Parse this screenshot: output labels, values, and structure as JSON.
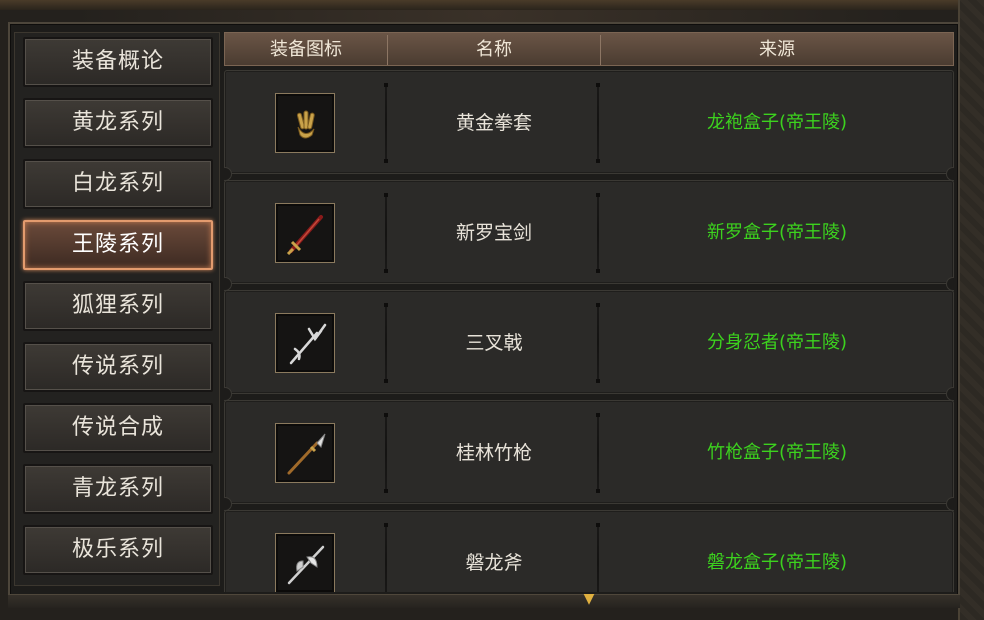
{
  "sidebar": {
    "items": [
      {
        "label": "装备概论",
        "active": false
      },
      {
        "label": "黄龙系列",
        "active": false
      },
      {
        "label": "白龙系列",
        "active": false
      },
      {
        "label": "王陵系列",
        "active": true
      },
      {
        "label": "狐狸系列",
        "active": false
      },
      {
        "label": "传说系列",
        "active": false
      },
      {
        "label": "传说合成",
        "active": false
      },
      {
        "label": "青龙系列",
        "active": false
      },
      {
        "label": "极乐系列",
        "active": false
      }
    ]
  },
  "table": {
    "headers": [
      "装备图标",
      "名称",
      "来源"
    ],
    "rows": [
      {
        "icon": "gold-gauntlet-icon",
        "name": "黄金拳套",
        "source": "龙袍盒子(帝王陵)"
      },
      {
        "icon": "sword-icon",
        "name": "新罗宝剑",
        "source": "新罗盒子(帝王陵)"
      },
      {
        "icon": "trident-icon",
        "name": "三叉戟",
        "source": "分身忍者(帝王陵)"
      },
      {
        "icon": "spear-icon",
        "name": "桂林竹枪",
        "source": "竹枪盒子(帝王陵)"
      },
      {
        "icon": "halberd-axe-icon",
        "name": "磐龙斧",
        "source": "磐龙盒子(帝王陵)"
      }
    ]
  },
  "colors": {
    "source_text": "#3cd21e",
    "active_border": "#e39b6e",
    "scroll_arrow": "#e0b040"
  },
  "scroll_indicator": "chevron-down-icon"
}
